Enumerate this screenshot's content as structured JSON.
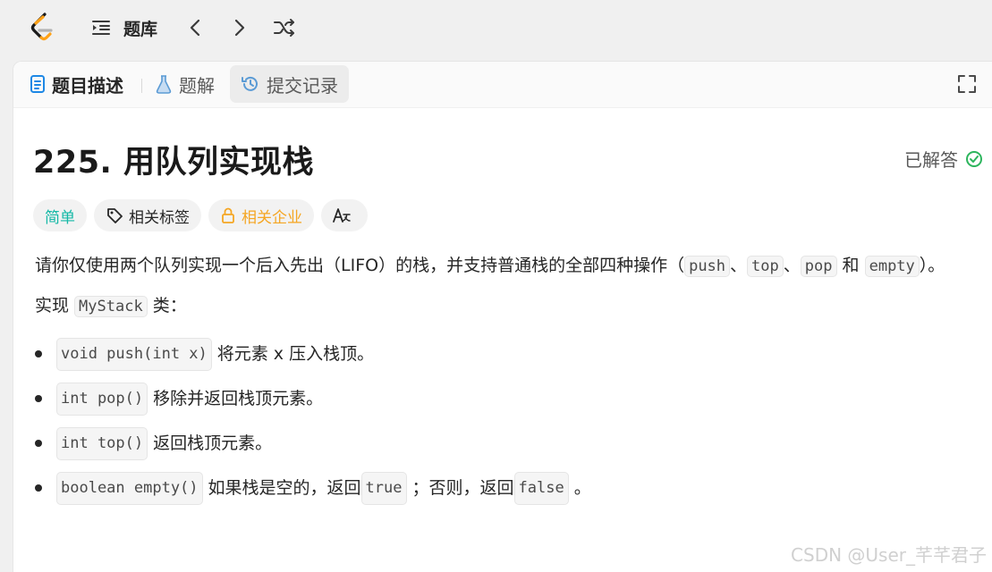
{
  "topbar": {
    "title": "题库"
  },
  "tabs": {
    "description": "题目描述",
    "solutions": "题解",
    "submissions": "提交记录"
  },
  "problem": {
    "title": "225. 用队列实现栈",
    "status": "已解答"
  },
  "tags": {
    "difficulty": "简单",
    "related_tags": "相关标签",
    "related_companies": "相关企业",
    "translate_glyph": "A文"
  },
  "description": {
    "p1_pre": "请你仅使用两个队列实现一个后入先出（LIFO）的栈，并支持普通栈的全部四种操作（",
    "p1_code1": "push",
    "p1_sep1": "、",
    "p1_code2": "top",
    "p1_sep2": "、",
    "p1_code3": "pop",
    "p1_and": " 和 ",
    "p1_code4": "empty",
    "p1_end": "）。",
    "p2_pre": "实现 ",
    "p2_code": "MyStack",
    "p2_post": " 类：",
    "methods": [
      {
        "code": "void push(int x)",
        "text": "将元素 x 压入栈顶。"
      },
      {
        "code": "int pop()",
        "text": "移除并返回栈顶元素。"
      },
      {
        "code": "int top()",
        "text": "返回栈顶元素。"
      }
    ],
    "m4_code": "boolean empty()",
    "m4_text1": "如果栈是空的，返回 ",
    "m4_code_true": "true",
    "m4_text2": " ；否则，返回 ",
    "m4_code_false": "false",
    "m4_text3": " 。"
  },
  "watermark": "CSDN @User_芊芊君子",
  "colors": {
    "easy": "#14b8a6",
    "company": "#f5a623",
    "solved_check": "#2db55d",
    "tab_desc_icon": "#1e88e5",
    "tab_sol_icon": "#5b9bd5"
  }
}
